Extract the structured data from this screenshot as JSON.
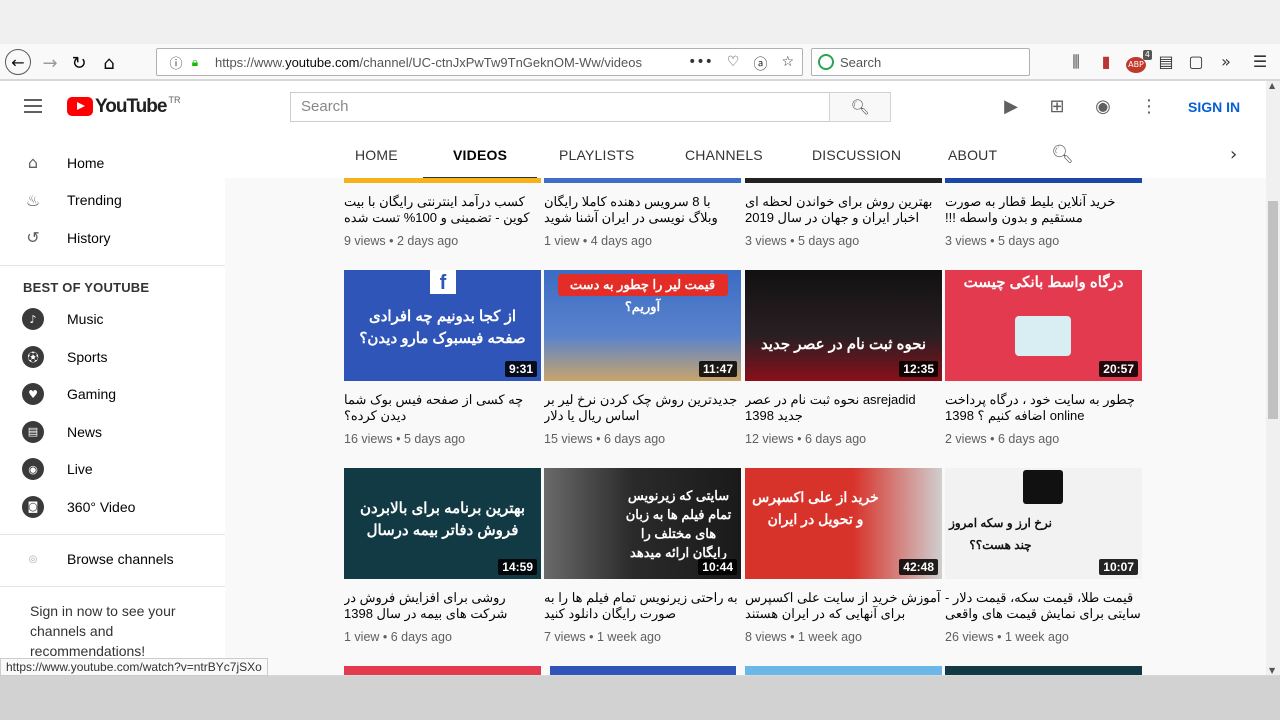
{
  "browser": {
    "url": "https://www.youtube.com/channel/UC-ctnJxPwTw9TnGeknOM-Ww/videos",
    "url_prefix": "https://www.",
    "url_domain": "youtube.com",
    "url_path": "/channel/UC-ctnJxPwTw9TnGeknOM-Ww/videos",
    "search_placeholder": "Search",
    "abp_count": "4",
    "status_url": "https://www.youtube.com/watch?v=ntrBYc7jSXo"
  },
  "yt": {
    "logo_word": "YouTube",
    "logo_region": "TR",
    "search_placeholder": "Search",
    "signin": "SIGN IN"
  },
  "sidebar": {
    "primary": [
      {
        "label": "Home",
        "icon": "home-icon"
      },
      {
        "label": "Trending",
        "icon": "flame-icon"
      },
      {
        "label": "History",
        "icon": "history-icon"
      }
    ],
    "best_heading": "BEST OF YOUTUBE",
    "best": [
      {
        "label": "Music",
        "icon": "music-icon"
      },
      {
        "label": "Sports",
        "icon": "sports-icon"
      },
      {
        "label": "Gaming",
        "icon": "gaming-icon"
      },
      {
        "label": "News",
        "icon": "news-icon"
      },
      {
        "label": "Live",
        "icon": "live-icon"
      },
      {
        "label": "360° Video",
        "icon": "vr-icon"
      }
    ],
    "browse": "Browse channels",
    "signin_prompt_1": "Sign in now to see your",
    "signin_prompt_2": "channels and",
    "signin_prompt_3": "recommendations!"
  },
  "tabs": [
    "HOME",
    "VIDEOS",
    "PLAYLISTS",
    "CHANNELS",
    "DISCUSSION",
    "ABOUT"
  ],
  "active_tab": "VIDEOS",
  "rows": [
    [
      {
        "title": "کسب درآمد اینترنتی رایگان با بیت کوین - تضمینی و 100% تست شده",
        "meta": "9 views • 2 days ago"
      },
      {
        "title": "با 8 سرویس دهنده کاملا رایگان وبلاگ نویسی در ایران آشنا شوید",
        "meta": "1 view • 4 days ago"
      },
      {
        "title": "بهترین روش برای خواندن لحظه ای اخبار ایران و جهان در سال 2019",
        "meta": "3 views • 5 days ago"
      },
      {
        "title": "خرید آنلاین بلیط قطار به صورت مستقیم و بدون واسطه !!!",
        "meta": "3 views • 5 days ago"
      }
    ],
    [
      {
        "title": "چه کسی از صفحه فیس بوک شما دیدن کرده؟",
        "meta": "16 views • 5 days ago",
        "duration": "9:31",
        "thumb_text": "از کجا بدونیم چه افرادی صفحه فیسبوک مارو دیدن؟",
        "bg": "#2f55b8"
      },
      {
        "title": "جدیدترین روش چک کردن نرخ لیر بر اساس ریال یا دلار",
        "meta": "15 views • 6 days ago",
        "duration": "11:47",
        "thumb_text": "قیمت لیر را چطور به دست آوریم؟",
        "bg": "#3b6cc4"
      },
      {
        "title": "asrejadid نحوه ثبت نام در عصر جدید 1398",
        "meta": "12 views • 6 days ago",
        "duration": "12:35",
        "thumb_text": "نحوه ثبت نام در عصر جدید",
        "bg": "#1a1a1a"
      },
      {
        "title": "چطور به سایت خود ، درگاه پرداخت online اضافه کنیم ؟ 1398",
        "meta": "2 views • 6 days ago",
        "duration": "20:57",
        "thumb_text": "درگاه واسط بانکی چیست",
        "bg": "#e43a4f"
      }
    ],
    [
      {
        "title": "روشی برای افزایش فروش در شرکت های بیمه در سال 1398",
        "meta": "1 view • 6 days ago",
        "duration": "14:59",
        "thumb_text": "بهترین برنامه برای بالابردن فروش دفاتر بیمه درسال",
        "bg": "#123a44"
      },
      {
        "title": "به راحتی زیرنویس تمام فیلم ها را به صورت رایگان دانلود کنید",
        "meta": "7 views • 1 week ago",
        "duration": "10:44",
        "thumb_text": "سایتی که زیرنویس تمام فیلم ها به زبان های مختلف را رایگان ارائه میدهد",
        "bg": "#2a2a2a"
      },
      {
        "title": "آموزش خرید از سایت علی اکسپرس برای آنهایی که در ایران هستند",
        "meta": "8 views • 1 week ago",
        "duration": "42:48",
        "thumb_text": "خرید از علی اکسپرس و تحویل در ایران",
        "bg": "#d8332b"
      },
      {
        "title": "قیمت طلا، قیمت سکه، قیمت دلار - سایتی برای نمایش قیمت های واقعی ارزها در",
        "meta": "26 views • 1 week ago",
        "duration": "10:07",
        "thumb_text": "نرخ ارز و سکه امروز چند هست؟؟",
        "bg": "#f2f2f2"
      }
    ]
  ]
}
